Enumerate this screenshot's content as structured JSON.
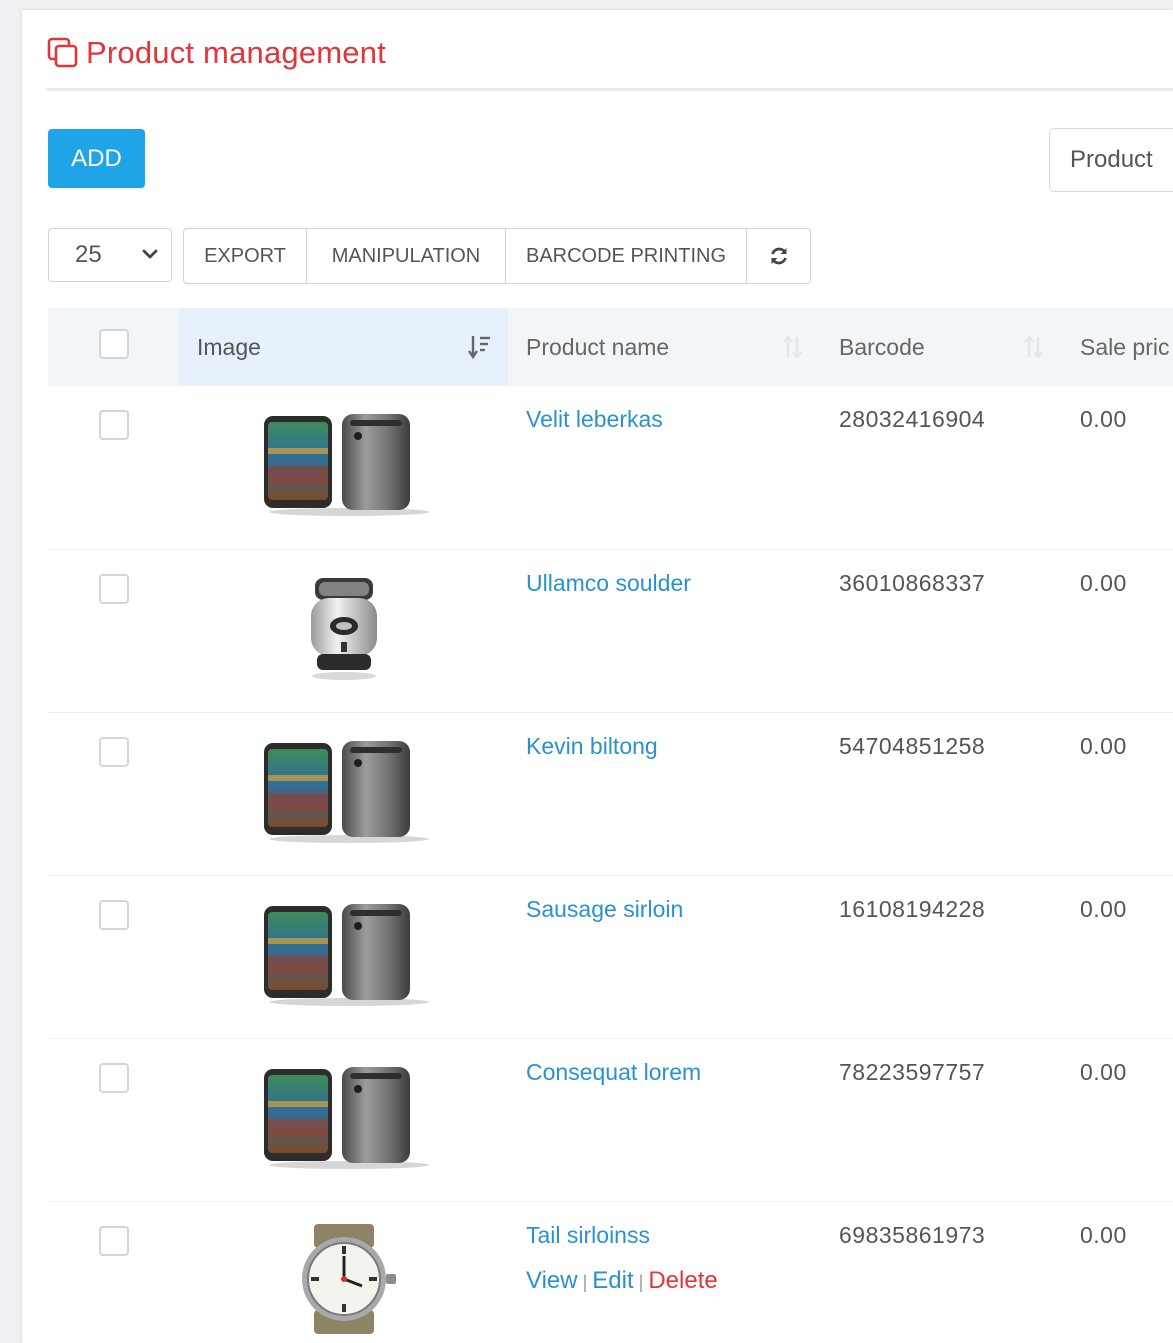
{
  "header": {
    "title": "Product management",
    "icon": "copy-icon"
  },
  "toolbar": {
    "add_label": "ADD",
    "search_placeholder": "Product",
    "page_size": "25",
    "export_label": "EXPORT",
    "manipulation_label": "MANIPULATION",
    "barcode_printing_label": "BARCODE PRINTING",
    "refresh_icon": "refresh-icon"
  },
  "table": {
    "columns": {
      "image": "Image",
      "product_name": "Product name",
      "barcode": "Barcode",
      "sale_price": "Sale pric"
    },
    "sorted_column": "image",
    "rows": [
      {
        "name": "Velit leberkas",
        "barcode": "28032416904",
        "price": "0.00",
        "image": "phone-pair-icon"
      },
      {
        "name": "Ullamco soulder",
        "barcode": "36010868337",
        "price": "0.00",
        "image": "coffee-grinder-icon"
      },
      {
        "name": "Kevin biltong",
        "barcode": "54704851258",
        "price": "0.00",
        "image": "phone-pair-icon"
      },
      {
        "name": "Sausage sirloin",
        "barcode": "16108194228",
        "price": "0.00",
        "image": "phone-pair-icon"
      },
      {
        "name": "Consequat lorem",
        "barcode": "78223597757",
        "price": "0.00",
        "image": "phone-pair-icon"
      },
      {
        "name": "Tail sirloinss",
        "barcode": "69835861973",
        "price": "0.00",
        "image": "wristwatch-icon"
      }
    ],
    "row_actions": {
      "view": "View",
      "edit": "Edit",
      "delete": "Delete",
      "separator": "|"
    }
  },
  "colors": {
    "title_red": "#e0363b",
    "add_blue": "#1fa4e8",
    "link_blue": "#2a91d0"
  }
}
